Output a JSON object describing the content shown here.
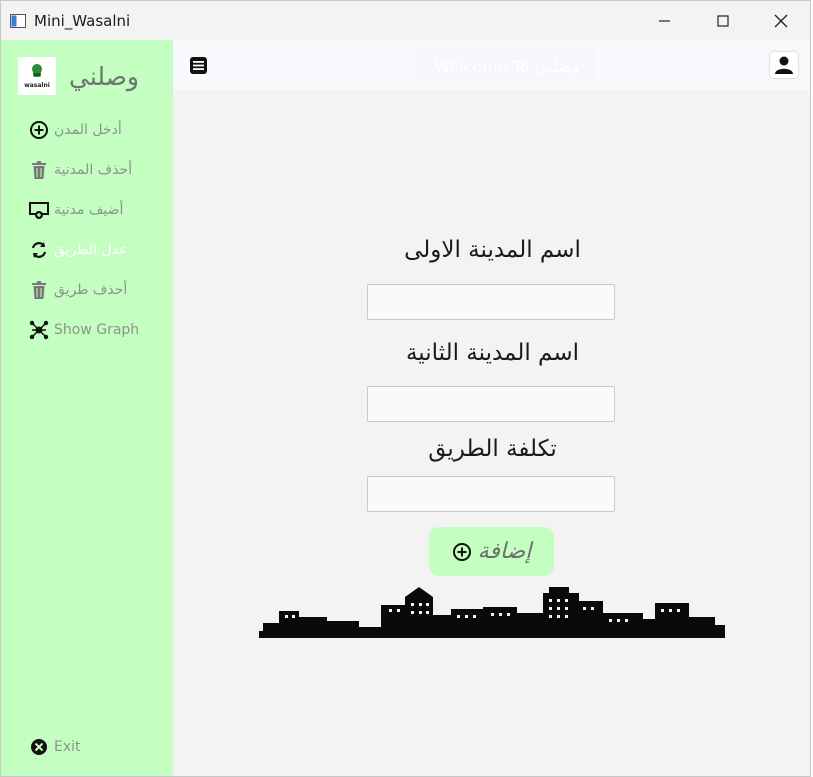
{
  "window": {
    "title": "Mini_Wasalni",
    "controls": {
      "minimize": "minimize-icon",
      "maximize": "maximize-icon",
      "close": "close-icon"
    }
  },
  "sidebar": {
    "logo_caption": "wasalni",
    "logo_text": "وصلني",
    "items": [
      {
        "label": "أدخل المدن",
        "icon": "add-circle-icon"
      },
      {
        "label": "أحذف المدنية",
        "icon": "trash-icon"
      },
      {
        "label": "أضيف مدنية",
        "icon": "monitor-add-icon"
      },
      {
        "label": "عدل الطريق",
        "icon": "swap-icon"
      },
      {
        "label": "أحذف طريق",
        "icon": "trash-icon"
      },
      {
        "label": "Show Graph",
        "icon": "graph-icon"
      }
    ],
    "exit_label": "Exit"
  },
  "header": {
    "welcome_text": "Welcome To وصلني"
  },
  "form": {
    "city1_label": "اسم المدينة الاولى",
    "city1_value": "",
    "city2_label": "اسم المدينة الثانية",
    "city2_value": "",
    "cost_label": "تكلفة الطريق",
    "cost_value": "",
    "submit_label": "إضافة"
  },
  "colors": {
    "sidebar_bg": "#c4fec0",
    "main_bg": "#f3f3f3",
    "accent": "#c4fec0"
  }
}
